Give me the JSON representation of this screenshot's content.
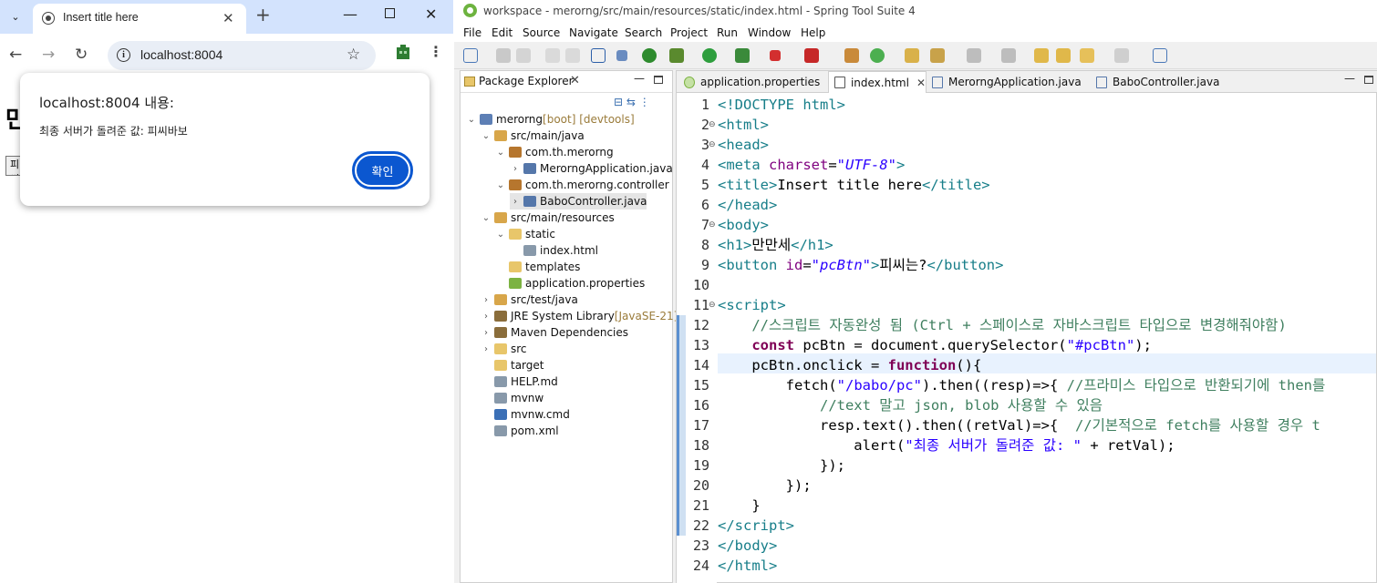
{
  "browser": {
    "tab_title": "Insert title here",
    "url": "localhost:8004",
    "page": {
      "heading": "만만세",
      "button_label": "피씨는?"
    },
    "alert": {
      "title": "localhost:8004 내용:",
      "message": "최종 서버가 돌려준 값: 피씨바보",
      "ok_label": "확인"
    }
  },
  "ide": {
    "window_title": "workspace - merorng/src/main/resources/static/index.html - Spring Tool Suite 4",
    "menu": [
      "File",
      "Edit",
      "Source",
      "Navigate",
      "Search",
      "Project",
      "Run",
      "Window",
      "Help"
    ],
    "explorer": {
      "title": "Package Explorer",
      "tree": [
        {
          "label": "merorng",
          "deco": "[boot] [devtools]",
          "depth": 0,
          "expander": "v",
          "icon": "project-icon",
          "color": "#5d7fb5"
        },
        {
          "label": "src/main/java",
          "depth": 1,
          "expander": "v",
          "icon": "source-folder-icon",
          "color": "#d8a64a"
        },
        {
          "label": "com.th.merorng",
          "depth": 2,
          "expander": "v",
          "icon": "package-icon",
          "color": "#b6762e"
        },
        {
          "label": "MerorngApplication.java",
          "depth": 3,
          "expander": ">",
          "icon": "java-file-icon",
          "color": "#5577aa"
        },
        {
          "label": "com.th.merorng.controller",
          "depth": 2,
          "expander": "v",
          "icon": "package-icon",
          "color": "#b6762e"
        },
        {
          "label": "BaboController.java",
          "depth": 3,
          "expander": ">",
          "icon": "java-file-icon",
          "color": "#5577aa",
          "selected": true
        },
        {
          "label": "src/main/resources",
          "depth": 1,
          "expander": "v",
          "icon": "source-folder-icon",
          "color": "#d8a64a"
        },
        {
          "label": "static",
          "depth": 2,
          "expander": "v",
          "icon": "folder-icon",
          "color": "#e8c66a"
        },
        {
          "label": "index.html",
          "depth": 3,
          "expander": "",
          "icon": "html-file-icon",
          "color": "#8899aa"
        },
        {
          "label": "templates",
          "depth": 2,
          "expander": "",
          "icon": "folder-icon",
          "color": "#e8c66a"
        },
        {
          "label": "application.properties",
          "depth": 2,
          "expander": "",
          "icon": "properties-file-icon",
          "color": "#7cb342"
        },
        {
          "label": "src/test/java",
          "depth": 1,
          "expander": ">",
          "icon": "source-folder-icon",
          "color": "#d8a64a"
        },
        {
          "label": "JRE System Library",
          "deco": "[JavaSE-21]",
          "depth": 1,
          "expander": ">",
          "icon": "library-icon",
          "color": "#8a6d3b"
        },
        {
          "label": "Maven Dependencies",
          "depth": 1,
          "expander": ">",
          "icon": "library-icon",
          "color": "#8a6d3b"
        },
        {
          "label": "src",
          "depth": 1,
          "expander": ">",
          "icon": "folder-icon",
          "color": "#e8c66a"
        },
        {
          "label": "target",
          "depth": 1,
          "expander": "",
          "icon": "folder-icon",
          "color": "#e8c66a"
        },
        {
          "label": "HELP.md",
          "depth": 1,
          "expander": "",
          "icon": "md-file-icon",
          "color": "#8899aa"
        },
        {
          "label": "mvnw",
          "depth": 1,
          "expander": "",
          "icon": "file-icon",
          "color": "#8899aa"
        },
        {
          "label": "mvnw.cmd",
          "depth": 1,
          "expander": "",
          "icon": "cmd-file-icon",
          "color": "#3b6fb6"
        },
        {
          "label": "pom.xml",
          "depth": 1,
          "expander": "",
          "icon": "xml-file-icon",
          "color": "#8899aa"
        }
      ]
    },
    "editor_tabs": [
      {
        "label": "application.properties",
        "active": false
      },
      {
        "label": "index.html",
        "active": true
      },
      {
        "label": "MerorngApplication.java",
        "active": false
      },
      {
        "label": "BaboController.java",
        "active": false
      }
    ],
    "code": [
      {
        "n": "1",
        "fold": "",
        "html": "<span class='tag'>&lt;!DOCTYPE html&gt;</span>"
      },
      {
        "n": "2",
        "fold": "⊖",
        "html": "<span class='tag'>&lt;html&gt;</span>"
      },
      {
        "n": "3",
        "fold": "⊖",
        "html": "<span class='tag'>&lt;head&gt;</span>"
      },
      {
        "n": "4",
        "fold": "",
        "html": "<span class='tag'>&lt;meta </span><span class='attr'>charset</span>=<span class='str'>\"UTF-8\"</span><span class='tag'>&gt;</span>"
      },
      {
        "n": "5",
        "fold": "",
        "html": "<span class='tag'>&lt;title&gt;</span>Insert title here<span class='tag'>&lt;/title&gt;</span>"
      },
      {
        "n": "6",
        "fold": "",
        "html": "<span class='tag'>&lt;/head&gt;</span>"
      },
      {
        "n": "7",
        "fold": "⊖",
        "html": "<span class='tag'>&lt;body&gt;</span>"
      },
      {
        "n": "8",
        "fold": "",
        "html": "<span class='tag'>&lt;h1&gt;</span>만만세<span class='tag'>&lt;/h1&gt;</span>"
      },
      {
        "n": "9",
        "fold": "",
        "html": "<span class='tag'>&lt;button </span><span class='attr'>id</span>=<span class='str'>\"pcBtn\"</span><span class='tag'>&gt;</span>피씨는?<span class='tag'>&lt;/button&gt;</span>"
      },
      {
        "n": "10",
        "fold": "",
        "html": ""
      },
      {
        "n": "11",
        "fold": "⊖",
        "html": "<span class='tag'>&lt;script&gt;</span>"
      },
      {
        "n": "12",
        "fold": "",
        "html": "    <span class='cmt'>//스크립트 자동완성 됨 (Ctrl + 스페이스로 자바스크립트 타입으로 변경해줘야함)</span>"
      },
      {
        "n": "13",
        "fold": "",
        "html": "    <span class='kw'>const</span> pcBtn = document.querySelector(<span class='s2'>\"#pcBtn\"</span>);"
      },
      {
        "n": "14",
        "fold": "",
        "html": "    pcBtn.onclick = <span class='kw'>function</span>(){"
      },
      {
        "n": "15",
        "fold": "",
        "html": "        fetch(<span class='s2'>\"/babo/pc\"</span>).then((resp)=>{ <span class='cmt'>//프라미스 타입으로 반환되기에 then를</span>"
      },
      {
        "n": "16",
        "fold": "",
        "html": "            <span class='cmt'>//text 말고 json, blob 사용할 수 있음</span>"
      },
      {
        "n": "17",
        "fold": "",
        "html": "            resp.text().then((retVal)=>{  <span class='cmt'>//기본적으로 fetch를 사용할 경우 t</span>"
      },
      {
        "n": "18",
        "fold": "",
        "html": "                alert(<span class='s2'>\"최종 서버가 돌려준 값: \"</span> + retVal);"
      },
      {
        "n": "19",
        "fold": "",
        "html": "            });"
      },
      {
        "n": "20",
        "fold": "",
        "html": "        });"
      },
      {
        "n": "21",
        "fold": "",
        "html": "    }"
      },
      {
        "n": "22",
        "fold": "",
        "html": "<span class='tag'>&lt;/script&gt;</span>"
      },
      {
        "n": "23",
        "fold": "",
        "html": "<span class='tag'>&lt;/body&gt;</span>"
      },
      {
        "n": "24",
        "fold": "",
        "html": "<span class='tag'>&lt;/html&gt;</span>"
      }
    ]
  }
}
